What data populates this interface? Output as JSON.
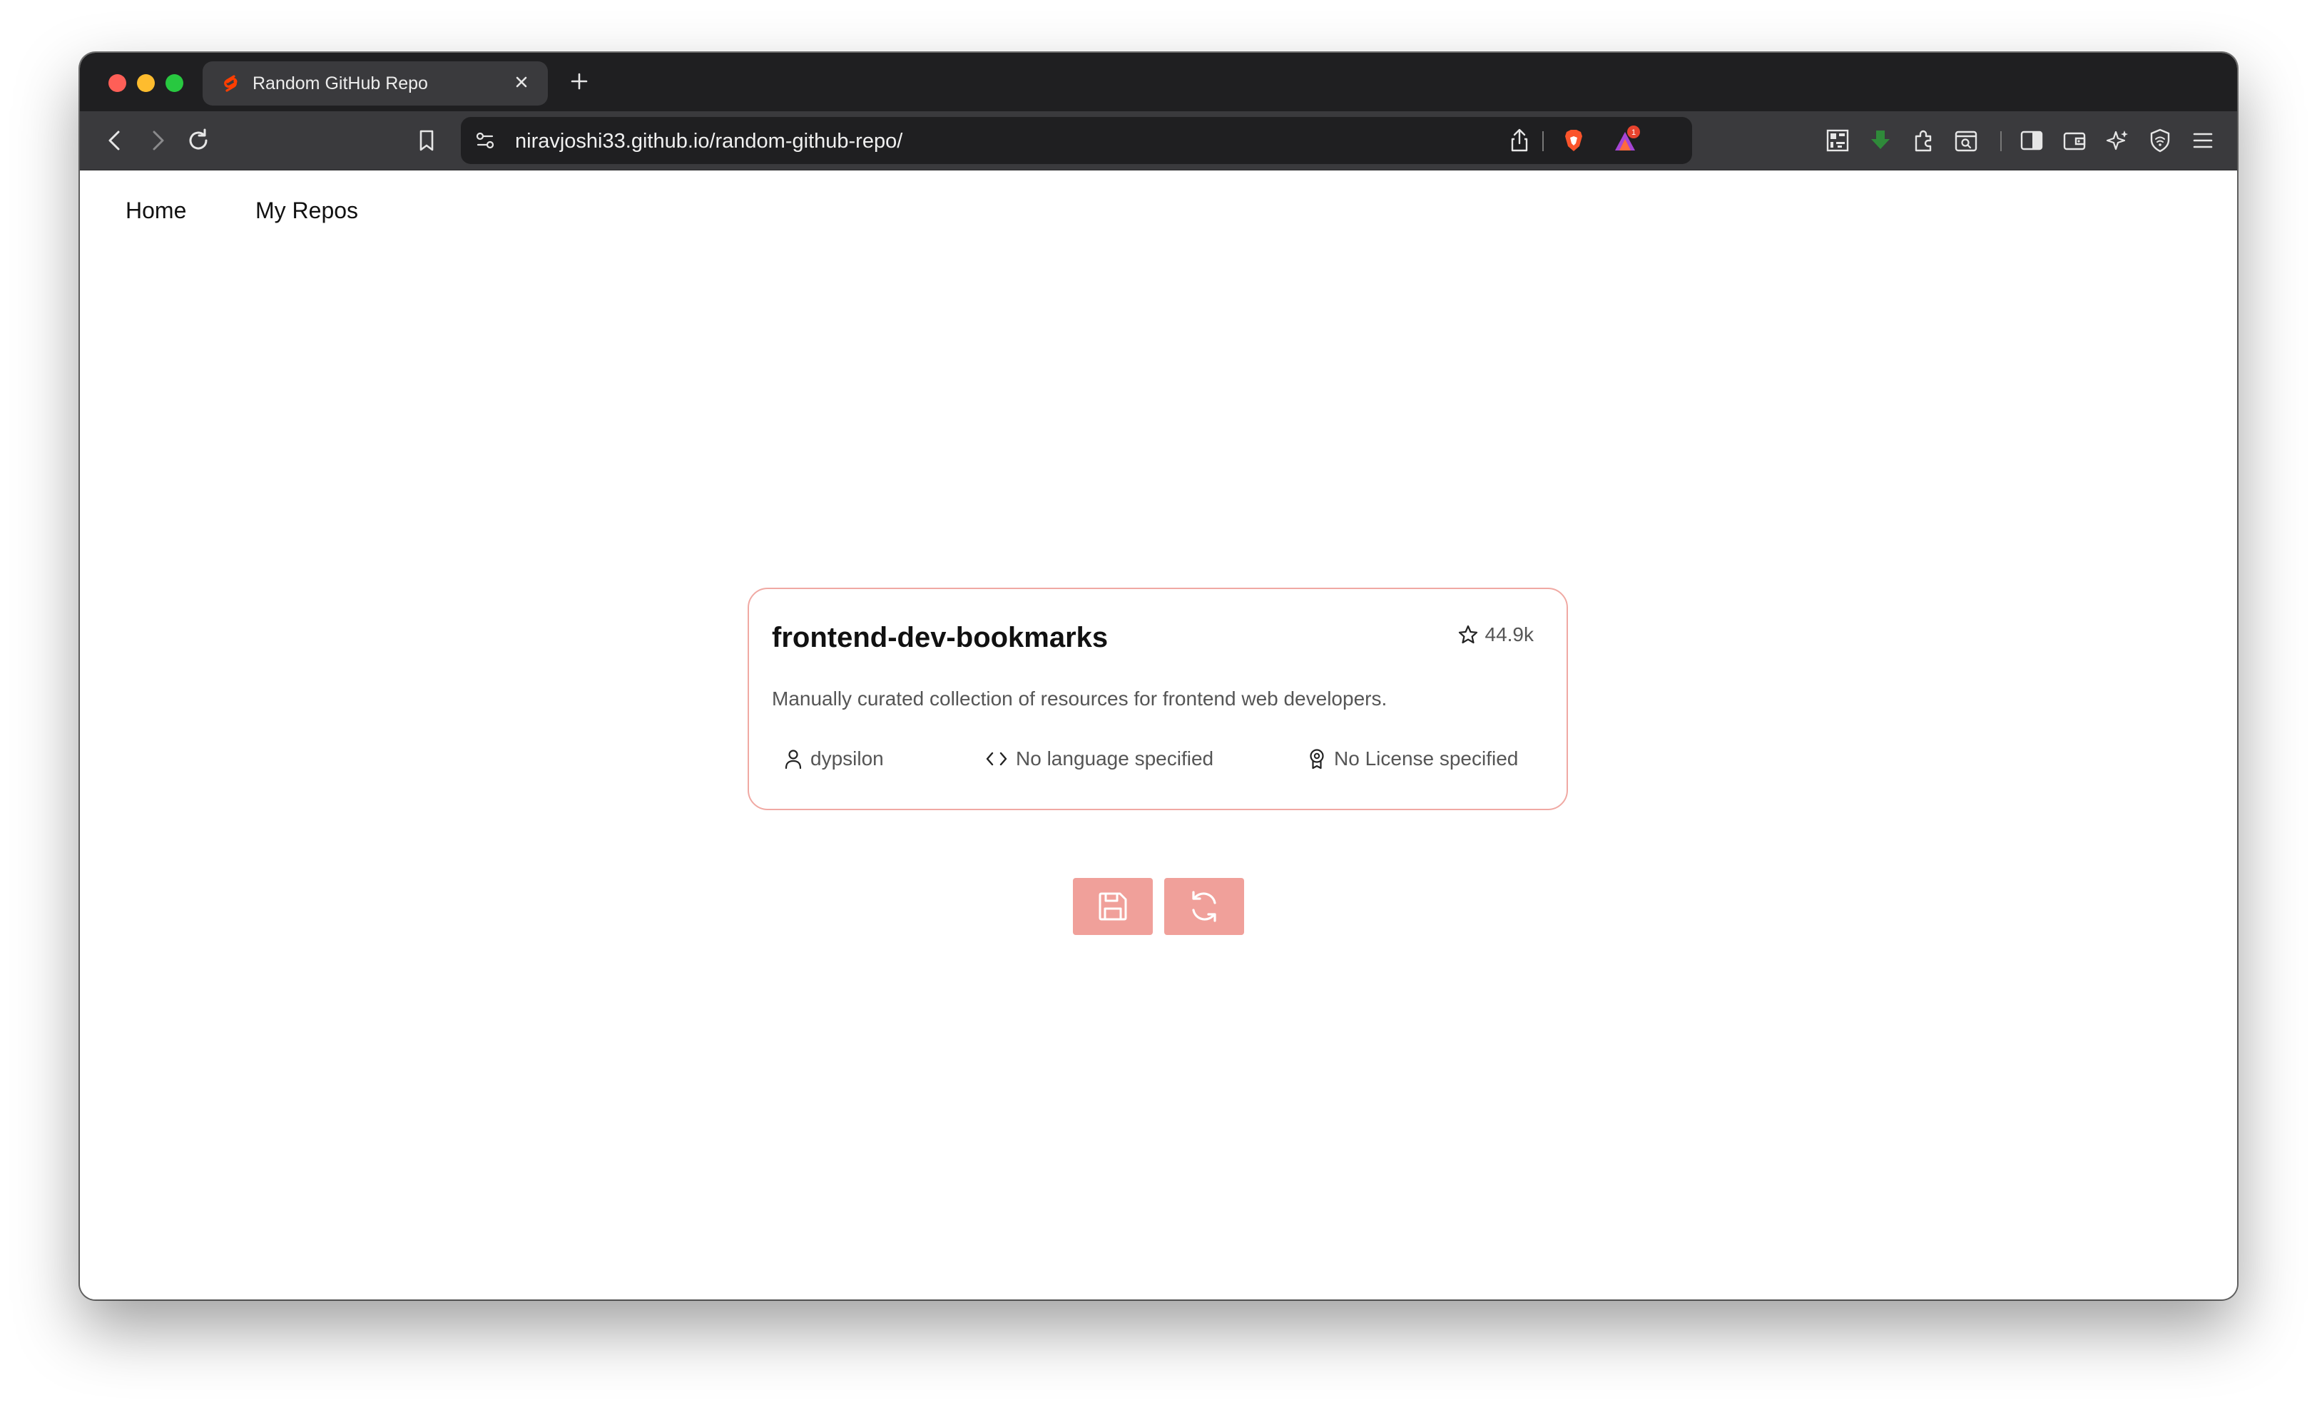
{
  "browser": {
    "tab": {
      "title": "Random GitHub Repo",
      "favicon": "svelte-icon"
    },
    "url": "niravjoshi33.github.io/random-github-repo/",
    "notification_badge": "1"
  },
  "nav": {
    "items": [
      {
        "label": "Home"
      },
      {
        "label": "My Repos"
      }
    ]
  },
  "repo": {
    "name": "frontend-dev-bookmarks",
    "stars": "44.9k",
    "description": "Manually curated collection of resources for frontend web developers.",
    "owner": "dypsilon",
    "language": "No language specified",
    "license": "No License specified"
  },
  "actions": {
    "save_icon": "save-icon",
    "refresh_icon": "refresh-icon"
  },
  "colors": {
    "accent": "#f0a09a",
    "card_border": "#f0a9a3",
    "tabstrip": "#1f1f21",
    "toolbar": "#3a3a3d"
  }
}
